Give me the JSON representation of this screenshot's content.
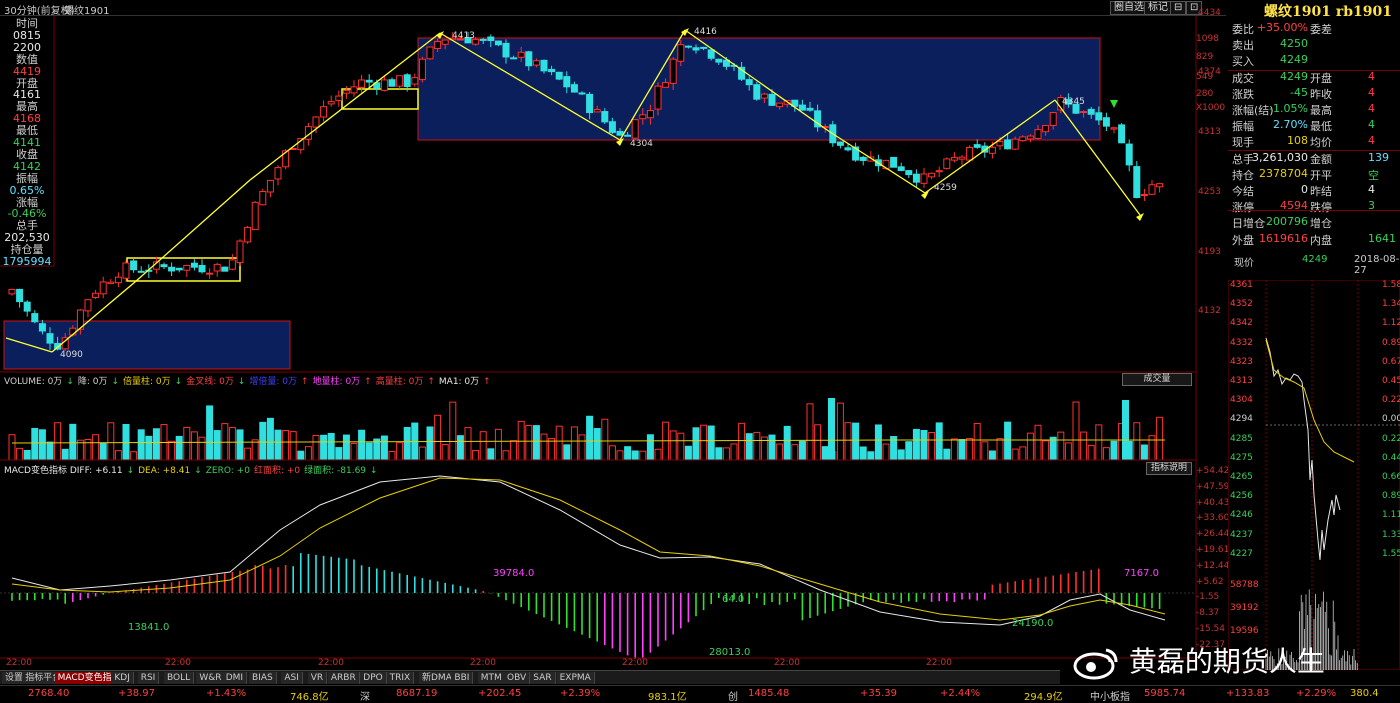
{
  "header": {
    "period": "30分钟(前复权)",
    "symbol_name": "螺纹1901",
    "buttons": [
      "圈自选",
      "标记",
      "⊟",
      "⊡"
    ]
  },
  "left_panel": [
    {
      "label": "时间",
      "color": "#d0d0d0"
    },
    {
      "label": "0815",
      "color": "#e8e8e8"
    },
    {
      "label": "2200",
      "color": "#e8e8e8"
    },
    {
      "label": "数值",
      "color": "#d0d0d0"
    },
    {
      "label": "4419",
      "color": "#ff4040"
    },
    {
      "label": "开盘",
      "color": "#d0d0d0"
    },
    {
      "label": "4161",
      "color": "#e8e8e8"
    },
    {
      "label": "最高",
      "color": "#d0d0d0"
    },
    {
      "label": "4168",
      "color": "#ff4040"
    },
    {
      "label": "最低",
      "color": "#d0d0d0"
    },
    {
      "label": "4141",
      "color": "#3ad05a"
    },
    {
      "label": "收盘",
      "color": "#d0d0d0"
    },
    {
      "label": "4142",
      "color": "#3ad05a"
    },
    {
      "label": "振幅",
      "color": "#d0d0d0"
    },
    {
      "label": "0.65%",
      "color": "#60e0ff"
    },
    {
      "label": "涨幅",
      "color": "#d0d0d0"
    },
    {
      "label": "-0.46%",
      "color": "#3ad05a"
    },
    {
      "label": "总手",
      "color": "#d0d0d0"
    },
    {
      "label": "202,530",
      "color": "#e8e8e8"
    },
    {
      "label": "持仓量",
      "color": "#d0d0d0"
    },
    {
      "label": "1795994",
      "color": "#60e0ff"
    }
  ],
  "price_axis": [
    "4434",
    "4374",
    "4313",
    "4253",
    "4193",
    "4132"
  ],
  "annotations": [
    "4413",
    "4416",
    "4304",
    "4345",
    "4259",
    "4090"
  ],
  "volume_header": [
    {
      "text": "VOLUME: 0万",
      "color": "#d0d0d0"
    },
    {
      "text": "↓",
      "color": "#3ad05a"
    },
    {
      "text": "降: 0万",
      "color": "#d0d0d0"
    },
    {
      "text": "↓",
      "color": "#3ad05a"
    },
    {
      "text": "倍量柱: 0万",
      "color": "#e8d000"
    },
    {
      "text": "↓",
      "color": "#3ad05a"
    },
    {
      "text": "金叉线: 0万",
      "color": "#ff4040"
    },
    {
      "text": "↓",
      "color": "#3ad05a"
    },
    {
      "text": "增倍量: 0万",
      "color": "#4040ff"
    },
    {
      "text": "↑",
      "color": "#ff4040"
    },
    {
      "text": "地量柱: 0万",
      "color": "#ff40ff"
    },
    {
      "text": "↑",
      "color": "#ff4040"
    },
    {
      "text": "高量柱: 0万",
      "color": "#ff4040"
    },
    {
      "text": "↑",
      "color": "#ff4040"
    },
    {
      "text": "MA1: 0万",
      "color": "#e8e8e8"
    },
    {
      "text": "↑",
      "color": "#ff4040"
    }
  ],
  "volume_button": "成交量",
  "volume_axis": [
    "1098",
    "829",
    "549",
    "280",
    "X1000"
  ],
  "macd_header": [
    {
      "text": "MACD变色指标 DIFF: +6.11",
      "color": "#e8e8e8"
    },
    {
      "text": "↓",
      "color": "#3ad05a"
    },
    {
      "text": "DEA: +8.41",
      "color": "#e8d000"
    },
    {
      "text": "↓",
      "color": "#3ad05a"
    },
    {
      "text": "ZERO: +0",
      "color": "#3ad05a"
    },
    {
      "text": "红面积: +0",
      "color": "#ff4040"
    },
    {
      "text": "绿面积: -81.69",
      "color": "#3ad05a"
    },
    {
      "text": "↓",
      "color": "#3ad05a"
    }
  ],
  "macd_button": "指标说明",
  "macd_axis": [
    "+54.42",
    "+47.59",
    "+40.43",
    "+33.60",
    "+26.44",
    "+19.61",
    "+12.44",
    "+5.62",
    "-1.55",
    "-8.37",
    "-15.54",
    "-22.37"
  ],
  "macd_labels": [
    "39784.0",
    "13841.0",
    "64.0",
    "28013.0",
    "24190.0",
    "7167.0"
  ],
  "time_axis": [
    "22:00",
    "22:00",
    "22:00",
    "22:00",
    "22:00",
    "22:00",
    "22:00"
  ],
  "tabs": [
    "设置",
    "指标平台",
    "MACD变色指标",
    "KDJ",
    "RSI",
    "BOLL",
    "W&R",
    "DMI",
    "BIAS",
    "ASI",
    "VR",
    "ARBR",
    "DPO",
    "TRIX",
    "新DMA",
    "BBI",
    "MTM",
    "OBV",
    "SAR",
    "EXPMA"
  ],
  "active_tab": "MACD变色指标",
  "right_panel": {
    "title": "螺纹1901 rb1901",
    "rows": [
      {
        "a": "委比",
        "b": "+35.00%",
        "bc": "#ff4040",
        "c": "委差",
        "d": "",
        "dc": "#ff4040"
      },
      {
        "a": "卖出",
        "b": "4250",
        "bc": "#3ad05a",
        "c": "",
        "d": "",
        "dc": "#e8e8e8"
      },
      {
        "a": "买入",
        "b": "4249",
        "bc": "#3ad05a",
        "c": "",
        "d": "",
        "dc": "#e8e8e8"
      },
      {
        "a": "成交",
        "b": "4249",
        "bc": "#3ad05a",
        "c": "开盘",
        "d": "4",
        "dc": "#ff4040"
      },
      {
        "a": "涨跌",
        "b": "-45",
        "bc": "#3ad05a",
        "c": "昨收",
        "d": "4",
        "dc": "#ff4040"
      },
      {
        "a": "涨幅(结)",
        "b": "-1.05%",
        "bc": "#3ad05a",
        "c": "最高",
        "d": "4",
        "dc": "#ff4040"
      },
      {
        "a": "振幅",
        "b": "2.70%",
        "bc": "#60e0ff",
        "c": "最低",
        "d": "4",
        "dc": "#3ad05a"
      },
      {
        "a": "现手",
        "b": "108",
        "bc": "#e8d000",
        "c": "均价",
        "d": "4",
        "dc": "#ff4040"
      },
      {
        "a": "总手",
        "b": "3,261,030",
        "bc": "#e8e8e8",
        "c": "金额",
        "d": "139",
        "dc": "#60e0ff"
      },
      {
        "a": "持仓",
        "b": "2378704",
        "bc": "#e8d000",
        "c": "开平",
        "d": "空",
        "dc": "#3ad05a"
      },
      {
        "a": "今结",
        "b": "0",
        "bc": "#e8e8e8",
        "c": "昨结",
        "d": "4",
        "dc": "#e8e8e8"
      },
      {
        "a": "涨停",
        "b": "4594",
        "bc": "#ff4040",
        "c": "跌停",
        "d": "3",
        "dc": "#3ad05a"
      },
      {
        "a": "日增仓",
        "b": "-200796",
        "bc": "#3ad05a",
        "c": "增仓",
        "d": "",
        "dc": "#e8e8e8"
      },
      {
        "a": "外盘",
        "b": "1619616",
        "bc": "#ff4040",
        "c": "内盘",
        "d": "1641",
        "dc": "#3ad05a"
      }
    ],
    "spot_label": "现价",
    "spot_value": "4249",
    "date": "2018-08-27"
  },
  "mini_axis_left": [
    "4361",
    "4352",
    "4342",
    "4332",
    "4323",
    "4313",
    "4304",
    "4294",
    "4285",
    "4275",
    "4265",
    "4256",
    "4246",
    "4237",
    "4227",
    "58788",
    "39192",
    "19596"
  ],
  "mini_axis_right": [
    "1.58",
    "1.34",
    "1.12",
    "0.89",
    "0.67",
    "0.45",
    "0.22",
    "0.00",
    "0.22",
    "0.44",
    "0.66",
    "0.89",
    "1.11",
    "1.33",
    "1.55"
  ],
  "status_bar": [
    {
      "text": "2768.40",
      "color": "#ff4040"
    },
    {
      "text": "+38.97",
      "color": "#ff4040"
    },
    {
      "text": "+1.43%",
      "color": "#ff4040"
    },
    {
      "text": "746.8亿",
      "color": "#e8d000"
    },
    {
      "text": "深",
      "color": "#d0d0d0"
    },
    {
      "text": "8687.19",
      "color": "#ff4040"
    },
    {
      "text": "+202.45",
      "color": "#ff4040"
    },
    {
      "text": "+2.39%",
      "color": "#ff4040"
    },
    {
      "text": "983.1亿",
      "color": "#e8d000"
    },
    {
      "text": "创",
      "color": "#d0d0d0"
    },
    {
      "text": "1485.48",
      "color": "#ff4040"
    },
    {
      "text": "+35.39",
      "color": "#ff4040"
    },
    {
      "text": "+2.44%",
      "color": "#ff4040"
    },
    {
      "text": "294.9亿",
      "color": "#e8d000"
    },
    {
      "text": "中小板指",
      "color": "#d0d0d0"
    },
    {
      "text": "5985.74",
      "color": "#ff4040"
    },
    {
      "text": "+133.83",
      "color": "#ff4040"
    },
    {
      "text": "+2.29%",
      "color": "#ff4040"
    },
    {
      "text": "380.4",
      "color": "#e8d000"
    }
  ],
  "watermark": "黄磊的期货人生",
  "colors": {
    "up": "#ff3030",
    "down": "#30e0e0",
    "box": "#0a1f5c",
    "trend": "#ffff30"
  }
}
